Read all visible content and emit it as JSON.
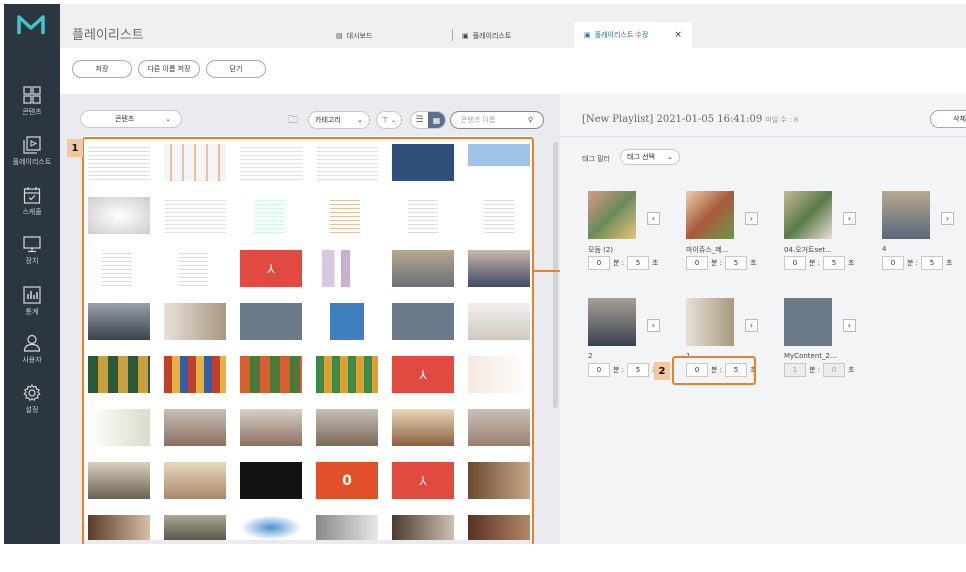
{
  "nav": {
    "items": [
      {
        "label": "콘텐츠",
        "icon": "grid-icon"
      },
      {
        "label": "플레이리스트",
        "icon": "playlist-icon"
      },
      {
        "label": "스케줄",
        "icon": "calendar-icon"
      },
      {
        "label": "장치",
        "icon": "monitor-icon"
      },
      {
        "label": "통계",
        "icon": "chart-icon"
      },
      {
        "label": "사용자",
        "icon": "user-icon"
      },
      {
        "label": "설정",
        "icon": "gear-icon"
      }
    ]
  },
  "header": {
    "title": "플레이리스트",
    "tabs": [
      {
        "label": "대시보드"
      },
      {
        "label": "플레이리스트"
      },
      {
        "label": "플레이리스트 수정"
      }
    ],
    "close_label": "×"
  },
  "toolbar": {
    "save_label": "저장",
    "save_as_label": "다른 이름 저장",
    "close_label": "닫기"
  },
  "content_panel": {
    "source_dropdown": "콘텐츠",
    "category_dropdown": "카테고리",
    "search_placeholder": "콘텐츠 이름",
    "badge_label": "1"
  },
  "playlist_panel": {
    "title": "[New Playlist] 2021-01-05 16:41:09",
    "count_label": "파일 수 : 8",
    "tag_filter_label": "태그 필터",
    "tag_select_label": "태그 선택",
    "delete_label": "삭제",
    "badge_label": "2",
    "minute_unit": "분 :",
    "second_unit": "초",
    "items": [
      {
        "name": "모듬 (2)",
        "min": "0",
        "sec": "5"
      },
      {
        "name": "마이쥬스_메...",
        "min": "0",
        "sec": "5"
      },
      {
        "name": "04.오거트set...",
        "min": "0",
        "sec": "5"
      },
      {
        "name": "4",
        "min": "0",
        "sec": "5"
      },
      {
        "name": "2",
        "min": "0",
        "sec": "5"
      },
      {
        "name": "1",
        "min": "0",
        "sec": "5"
      },
      {
        "name": "MyContent_2...",
        "min": "1",
        "sec": "0"
      }
    ]
  },
  "colors": {
    "sidebar": "#2c3640",
    "highlight": "#e8822a",
    "active_tab_text": "#2a6fc0"
  }
}
